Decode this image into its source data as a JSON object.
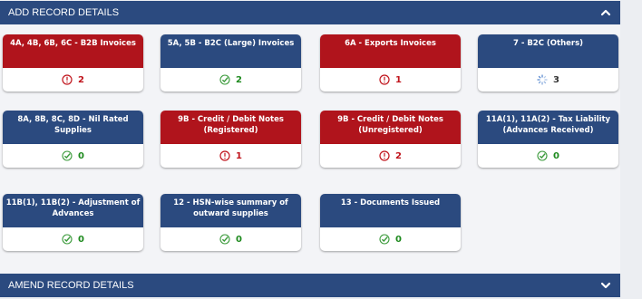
{
  "sections": {
    "add_label": "ADD RECORD DETAILS",
    "amend_label": "AMEND RECORD DETAILS"
  },
  "tiles": [
    {
      "title": "4A, 4B, 6B, 6C - B2B Invoices",
      "count": "2",
      "status": "warning",
      "color": "red"
    },
    {
      "title": "5A, 5B - B2C (Large) Invoices",
      "count": "2",
      "status": "ok",
      "color": "blue"
    },
    {
      "title": "6A - Exports Invoices",
      "count": "1",
      "status": "warning",
      "color": "red"
    },
    {
      "title": "7 - B2C (Others)",
      "count": "3",
      "status": "loading",
      "color": "blue"
    },
    {
      "title": "8A, 8B, 8C, 8D - Nil Rated Supplies",
      "count": "0",
      "status": "ok",
      "color": "blue"
    },
    {
      "title": "9B - Credit / Debit Notes (Registered)",
      "count": "1",
      "status": "warning",
      "color": "red"
    },
    {
      "title": "9B - Credit / Debit Notes (Unregistered)",
      "count": "2",
      "status": "warning",
      "color": "red"
    },
    {
      "title": "11A(1), 11A(2) - Tax Liability (Advances Received)",
      "count": "0",
      "status": "ok",
      "color": "blue"
    },
    {
      "title": "11B(1), 11B(2) - Adjustment of Advances",
      "count": "0",
      "status": "ok",
      "color": "blue"
    },
    {
      "title": "12 - HSN-wise summary of outward supplies",
      "count": "0",
      "status": "ok",
      "color": "blue"
    },
    {
      "title": "13 - Documents Issued",
      "count": "0",
      "status": "ok",
      "color": "blue"
    }
  ],
  "colors": {
    "red": "#b0141c",
    "blue": "#2b4a7f",
    "ok_green": "#1e8a1e",
    "warn_red": "#c0141c"
  },
  "icons": {
    "warning": "exclamation-circle-icon",
    "ok": "check-circle-icon",
    "loading": "spinner-icon",
    "add_chevron": "chevron-up-icon",
    "amend_chevron": "chevron-down-icon"
  }
}
